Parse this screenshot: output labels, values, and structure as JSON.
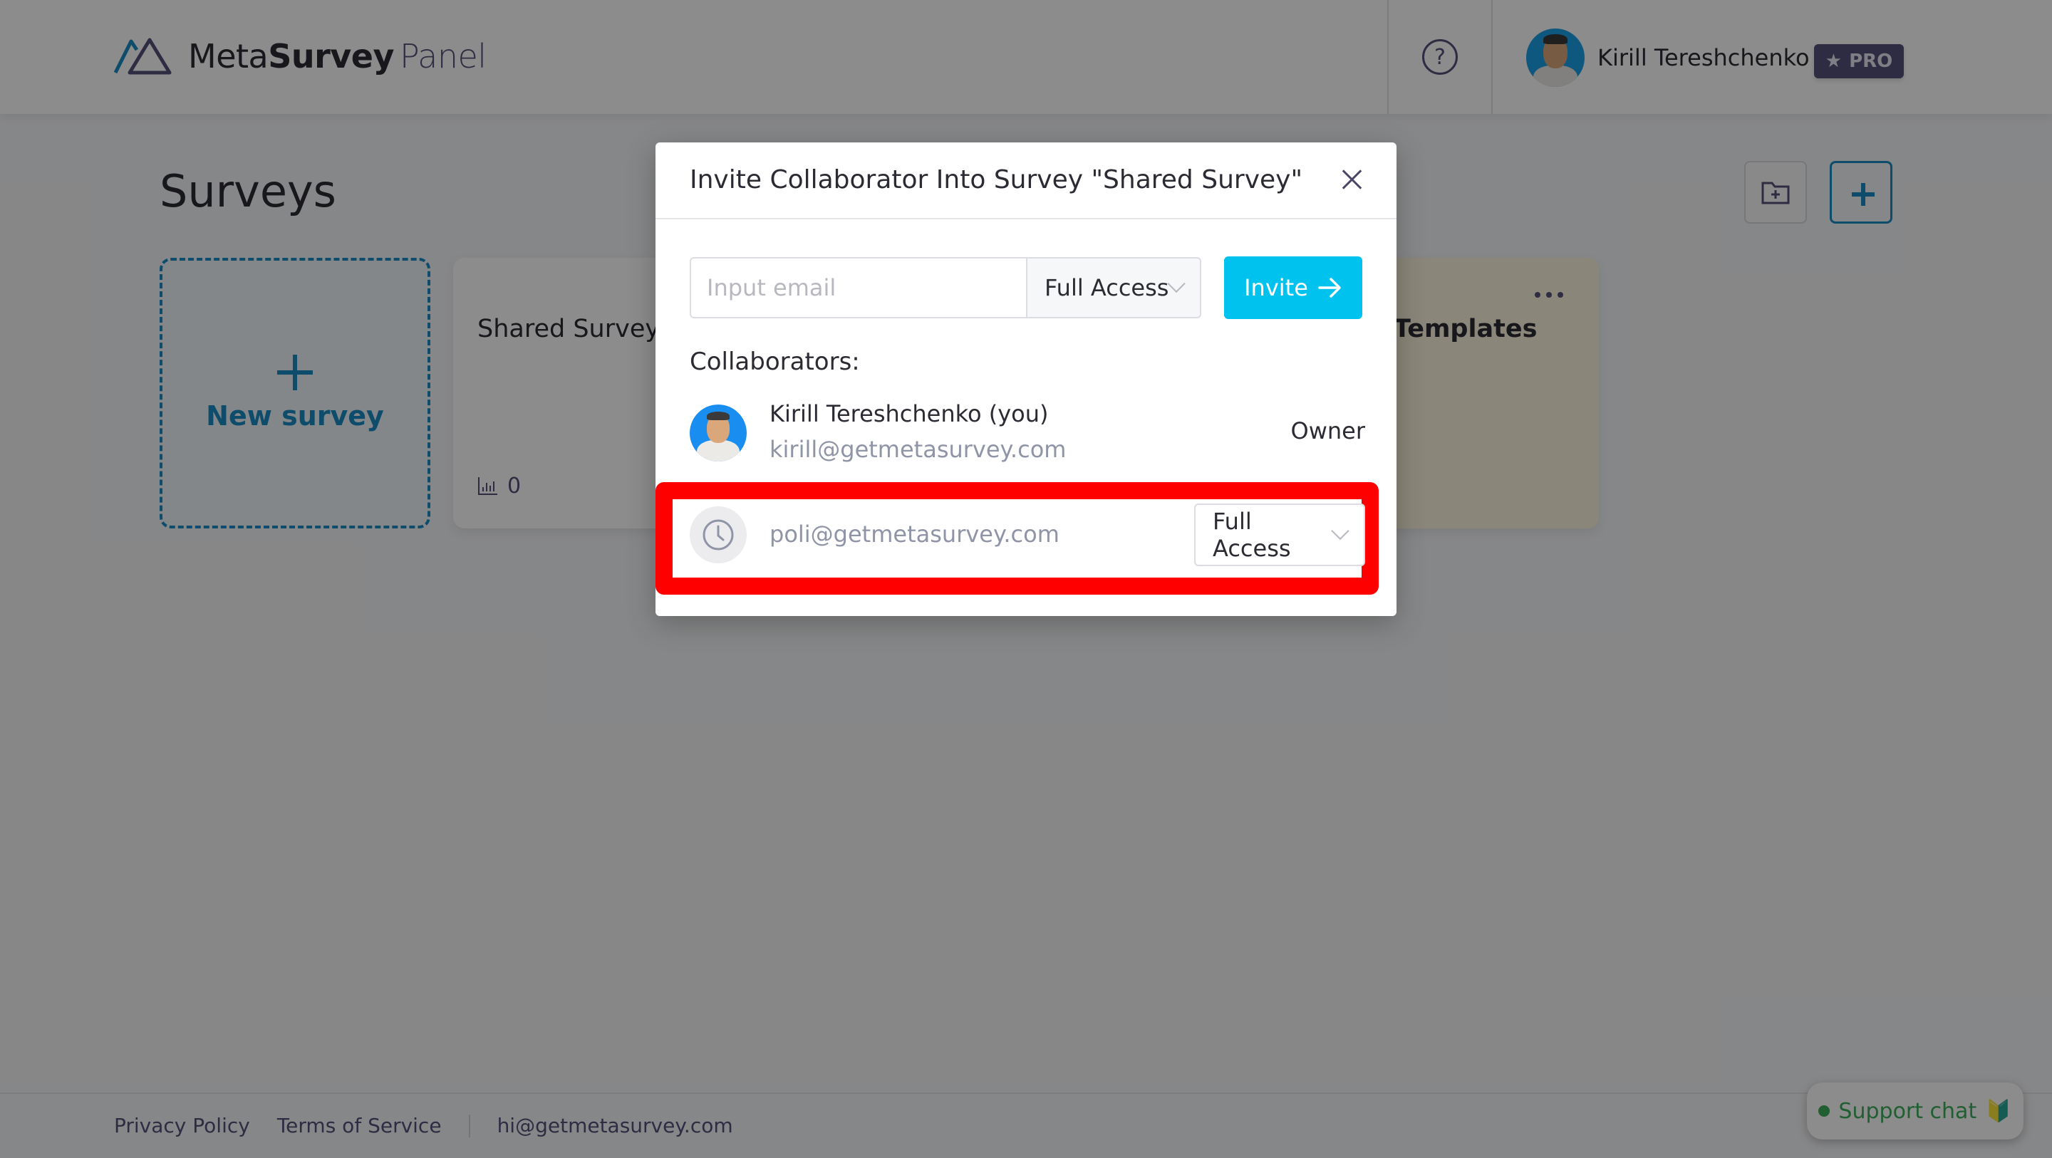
{
  "app": {
    "logo": {
      "meta": "Meta",
      "survey": "Survey",
      "panel": "Panel",
      "icon": "mountain-logo-icon"
    },
    "header": {
      "help_icon": "question-circle-icon",
      "user_name": "Kirill Tereshchenko",
      "user_menu_icon": "chevron-down-icon",
      "plan_badge": "PRO",
      "plan_badge_icon": "star-icon"
    }
  },
  "page": {
    "title": "Surveys",
    "toolbar": {
      "new_folder_icon": "folder-plus-icon",
      "new_survey_icon": "plus-icon"
    },
    "cards": [
      {
        "type": "new",
        "label": "New survey"
      },
      {
        "type": "survey",
        "title": "Shared Survey",
        "responses": "0"
      },
      {
        "type": "folder",
        "title": "Templates",
        "title_visible": "emplates",
        "menu_icon": "more-dots-icon"
      }
    ]
  },
  "footer": {
    "links": [
      "Privacy Policy",
      "Terms of Service"
    ],
    "email": "hi@getmetasurvey.com"
  },
  "support_chat": {
    "label": "Support chat",
    "emoji": "🔰",
    "status_color": "#3cae5c"
  },
  "modal": {
    "title": "Invite Collaborator Into Survey \"Shared Survey\"",
    "email_placeholder": "Input email",
    "email_value": "",
    "access_selected": "Full Access",
    "invite_button": "Invite",
    "collaborators_label": "Collaborators:",
    "collaborators": [
      {
        "name": "Kirill Tereshchenko (you)",
        "email": "kirill@getmetasurvey.com",
        "role": "Owner"
      }
    ],
    "pending": [
      {
        "email": "poli@getmetasurvey.com",
        "access": "Full Access",
        "status_icon": "clock-icon"
      }
    ]
  },
  "colors": {
    "brand_blue": "#1b8ac4",
    "invite_button": "#00c2ef",
    "brand_purple": "#55507a",
    "highlight": "#ff0000"
  }
}
